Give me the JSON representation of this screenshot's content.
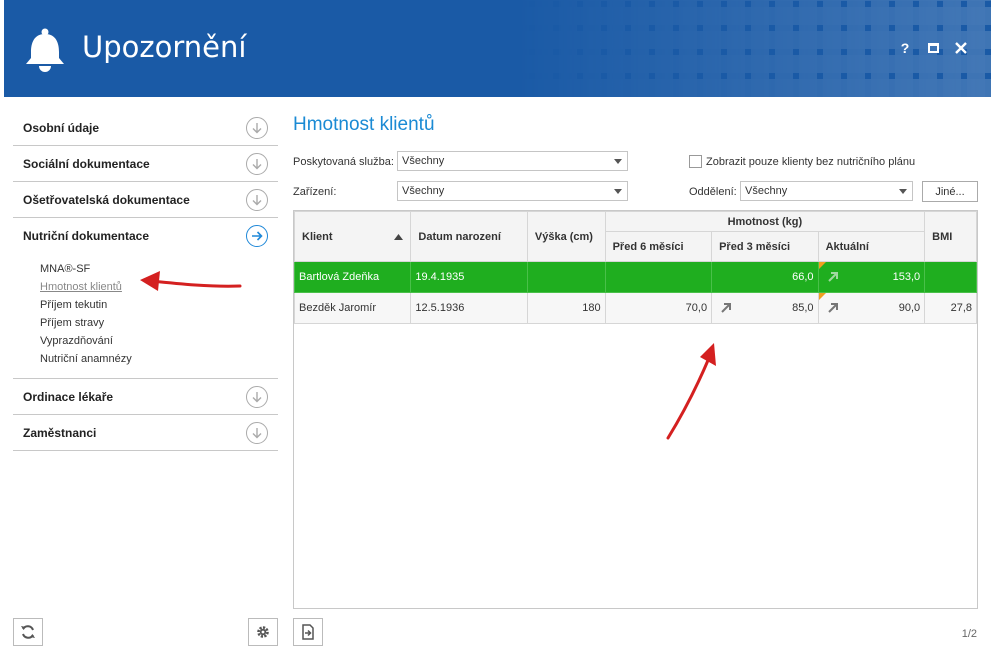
{
  "header": {
    "title": "Upozornění",
    "help": "?"
  },
  "sidebar": {
    "sections": [
      {
        "label": "Osobní údaje"
      },
      {
        "label": "Sociální dokumentace"
      },
      {
        "label": "Ošetřovatelská dokumentace"
      },
      {
        "label": "Nutriční dokumentace"
      },
      {
        "label": "Ordinace lékaře"
      },
      {
        "label": "Zaměstnanci"
      }
    ],
    "sub_items": [
      "MNA®-SF",
      "Hmotnost klientů",
      "Příjem tekutin",
      "Příjem stravy",
      "Vyprazdňování",
      "Nutriční anamnézy"
    ]
  },
  "main": {
    "title": "Hmotnost klientů",
    "service_label": "Poskytovaná služba:",
    "service_value": "Všechny",
    "facility_label": "Zařízení:",
    "facility_value": "Všechny",
    "checkbox_label": "Zobrazit pouze klienty bez nutričního plánu",
    "department_label": "Oddělení:",
    "department_value": "Všechny",
    "other_button": "Jiné..."
  },
  "table": {
    "headers": {
      "client": "Klient",
      "birth": "Datum narození",
      "height": "Výška (cm)",
      "weight_group": "Hmotnost (kg)",
      "before6": "Před 6 měsíci",
      "before3": "Před 3 měsíci",
      "current": "Aktuální",
      "bmi": "BMI"
    },
    "rows": [
      {
        "client": "Bartlová Zdeňka",
        "birth": "19.4.1935",
        "height": "",
        "before6": "",
        "before3": "66,0",
        "current": "153,0",
        "bmi": ""
      },
      {
        "client": "Bezděk Jaromír",
        "birth": "12.5.1936",
        "height": "180",
        "before6": "70,0",
        "before3": "85,0",
        "current": "90,0",
        "bmi": "27,8"
      }
    ]
  },
  "pager": "1/2",
  "colors": {
    "header_bg": "#1a5aa6",
    "accent": "#1a8ad4",
    "selected_row": "#1fae1f",
    "annotation_arrow": "#d42020"
  }
}
